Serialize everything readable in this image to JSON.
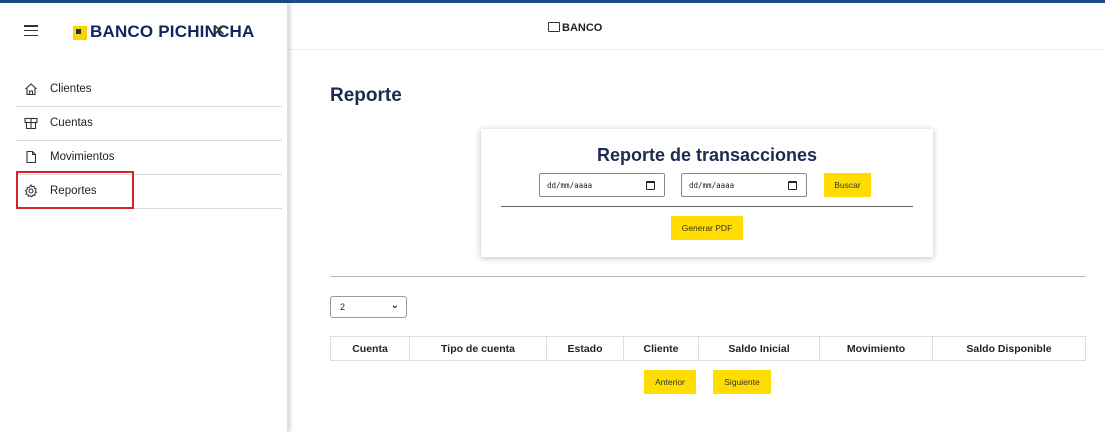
{
  "sidebar": {
    "brand": "BANCO PICHINCHA",
    "close_glyph": "✕",
    "items": [
      {
        "label": "Clientes",
        "icon": "home-icon"
      },
      {
        "label": "Cuentas",
        "icon": "accounts-icon"
      },
      {
        "label": "Movimientos",
        "icon": "document-icon"
      },
      {
        "label": "Reportes",
        "icon": "gear-icon"
      }
    ],
    "highlighted_item": "Reportes"
  },
  "topbar": {
    "brand": "BANCO"
  },
  "page": {
    "title": "Reporte"
  },
  "report_card": {
    "title": "Reporte de transacciones",
    "date_from_placeholder": "dd/mm/aaaa",
    "date_to_placeholder": "dd/mm/aaaa",
    "search_button": "Buscar",
    "pdf_button": "Generar PDF"
  },
  "page_size_select": {
    "value": "2"
  },
  "table": {
    "columns": [
      "Cuenta",
      "Tipo de cuenta",
      "Estado",
      "Cliente",
      "Saldo Inicial",
      "Movimiento",
      "Saldo Disponible"
    ]
  },
  "pagination": {
    "prev": "Anterior",
    "next": "Siguiente"
  },
  "colors": {
    "brand_navy": "#0f265c",
    "accent_yellow": "#ffdd00",
    "highlight_red": "#d6222a"
  }
}
